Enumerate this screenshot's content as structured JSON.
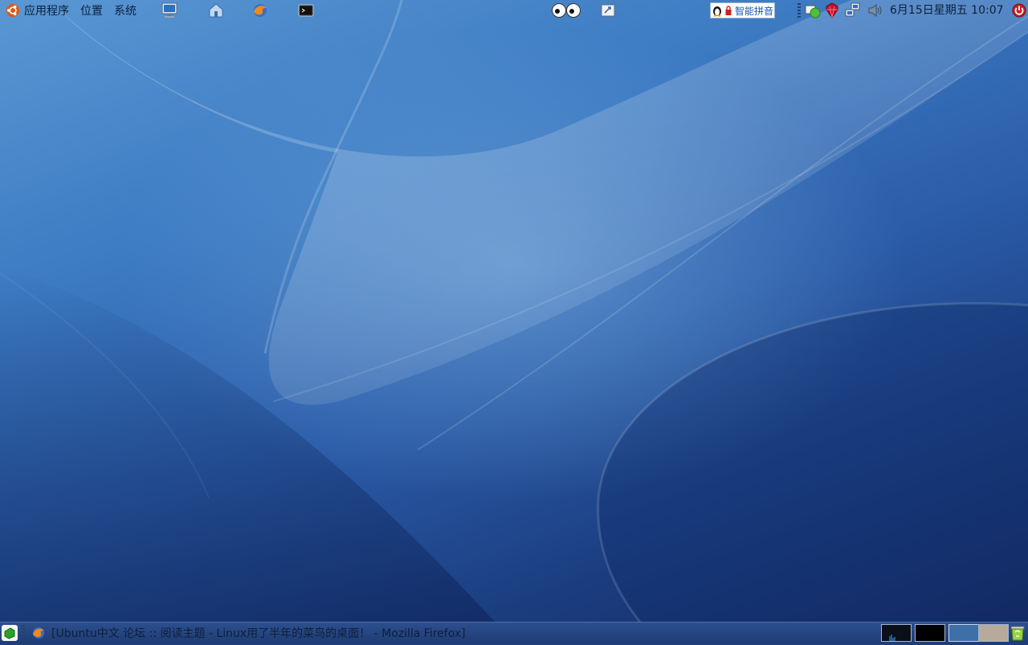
{
  "top_panel": {
    "menus": [
      {
        "label": "应用程序"
      },
      {
        "label": "位置"
      },
      {
        "label": "系统"
      }
    ],
    "launchers": [
      {
        "icon": "computer-icon"
      },
      {
        "icon": "home-folder-icon"
      },
      {
        "icon": "firefox-icon"
      },
      {
        "icon": "terminal-icon"
      }
    ],
    "applets": [
      {
        "icon": "eyes-applet-icon"
      },
      {
        "icon": "screenshot-icon"
      }
    ],
    "input_method": {
      "label": "智能拼音",
      "icon": "penguin-icon"
    },
    "tray": [
      {
        "icon": "messenger-status-icon"
      },
      {
        "icon": "ruby-gem-icon"
      },
      {
        "icon": "network-icon"
      },
      {
        "icon": "volume-icon"
      }
    ],
    "clock": "6月15日星期五 10:07",
    "shutdown_icon": "power-icon"
  },
  "bottom_panel": {
    "show_desktop_icon": "show-desktop-icon",
    "task": {
      "icon": "firefox-icon",
      "label": "[Ubuntu中文 论坛 :: 阅读主题 - Linux用了半年的菜鸟的桌面！ - Mozilla Firefox]"
    },
    "system_monitor": {
      "icon": "system-monitor-icon"
    },
    "workspaces": [
      {
        "color": "#000000"
      },
      {
        "color": "#3f6fa8"
      },
      {
        "color": "#b7aa9a"
      }
    ],
    "trash_icon": "trash-icon"
  },
  "colors": {
    "panel_text": "#0e1f3a",
    "wallpaper_light": "#5a97d4",
    "wallpaper_dark": "#13285f"
  }
}
